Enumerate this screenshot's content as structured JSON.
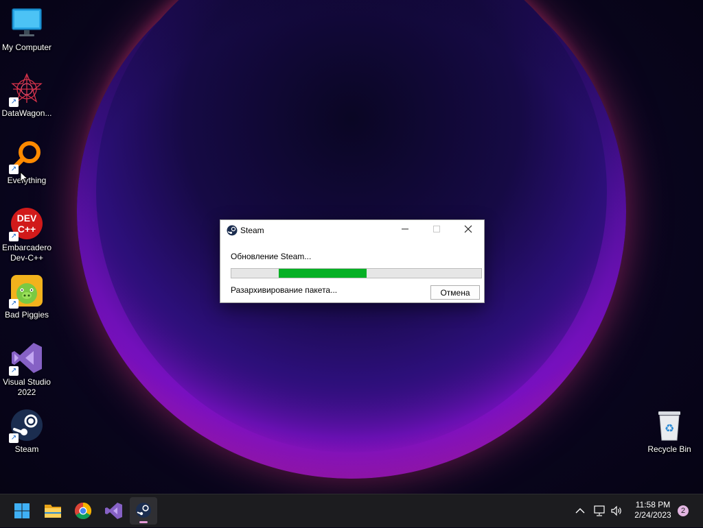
{
  "desktop": {
    "icons": [
      {
        "label": "My Computer",
        "icon": "monitor-icon"
      },
      {
        "label": "DataWagon...",
        "icon": "datawagon-icon"
      },
      {
        "label": "Everything",
        "icon": "magnifier-icon"
      },
      {
        "label": "Embarcadero Dev-C++",
        "icon": "devcpp-icon",
        "badge": "DEV C++"
      },
      {
        "label": "Bad Piggies",
        "icon": "bad-piggies-icon"
      },
      {
        "label": "Visual Studio 2022",
        "icon": "visual-studio-icon"
      },
      {
        "label": "Steam",
        "icon": "steam-icon"
      },
      {
        "label": "Recycle Bin",
        "icon": "recycle-bin-icon"
      }
    ]
  },
  "dialog": {
    "title": "Steam",
    "status": "Обновление Steam...",
    "progress": {
      "start": 0.19,
      "end": 0.54
    },
    "substatus": "Разархивирование пакета...",
    "cancel_label": "Отмена",
    "accent_color": "#06b025"
  },
  "taskbar": {
    "apps": [
      {
        "name": "start",
        "icon": "windows-start-icon"
      },
      {
        "name": "file-explorer",
        "icon": "folder-icon"
      },
      {
        "name": "chrome",
        "icon": "chrome-icon"
      },
      {
        "name": "visual-studio",
        "icon": "visual-studio-icon"
      },
      {
        "name": "steam",
        "icon": "steam-icon",
        "active": true
      }
    ],
    "clock": {
      "time": "11:58 PM",
      "date": "2/24/2023"
    },
    "notification_count": "2"
  }
}
